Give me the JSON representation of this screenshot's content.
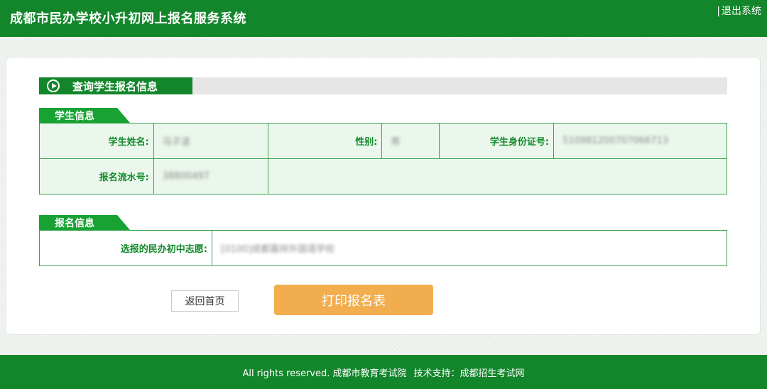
{
  "header": {
    "title": "成都市民办学校小升初网上报名服务系统",
    "separator": "|",
    "logout_label": "退出系统"
  },
  "section": {
    "title": "查询学生报名信息",
    "icon": "play-circle-icon"
  },
  "student_info": {
    "title": "学生信息",
    "name_label": "学生姓名:",
    "name_value": "马子凌",
    "gender_label": "性别:",
    "gender_value": "男",
    "id_label": "学生身份证号:",
    "id_value": "510981200707066713",
    "serial_label": "报名流水号:",
    "serial_value": "38800497"
  },
  "registration_info": {
    "title": "报名信息",
    "choice_label": "选报的民办初中志愿:",
    "choice_value": "[0100]成都嘉祥外国语学校"
  },
  "buttons": {
    "back_label": "返回首页",
    "print_label": "打印报名表"
  },
  "footer": {
    "copyright": "All rights reserved. 成都市教育考试院",
    "support": "技术支持：成都招生考试网"
  },
  "colors": {
    "brand_green": "#13862b",
    "accent_orange": "#f1ad4e",
    "table_bg": "#ebf7ec"
  }
}
